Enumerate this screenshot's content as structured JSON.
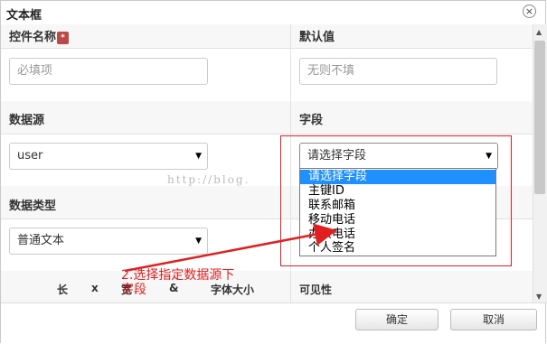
{
  "dialog": {
    "title": "文本框",
    "close_glyph": "×"
  },
  "rows": {
    "control_name_label": "控件名称",
    "required_mark": "*",
    "default_value_label": "默认值",
    "control_name_placeholder": "必填项",
    "default_value_placeholder": "无则不填",
    "datasource_label": "数据源",
    "field_label": "字段",
    "datasource_value": "user",
    "field_value": "请选择字段",
    "datatype_label": "数据类型",
    "datatype_value": "普通文本"
  },
  "dropdown": {
    "options": [
      "请选择字段",
      "主键ID",
      "联系邮箱",
      "移动电话",
      "办公电话",
      "个人签名"
    ],
    "selected_index": 0
  },
  "table_header": {
    "col1": "长",
    "col2": "x",
    "col3": "宽",
    "col4": "&",
    "col5": "字体大小",
    "col6": "可见性"
  },
  "watermark": "http://blog.",
  "annotation": {
    "line1": "2.选择指定数据源下",
    "line2": "字段",
    "color": "#e02020"
  },
  "footer": {
    "ok_label": "确定",
    "cancel_label": "取消"
  },
  "icons": {
    "close": "close-icon",
    "select_arrow": "caret-down-icon"
  }
}
